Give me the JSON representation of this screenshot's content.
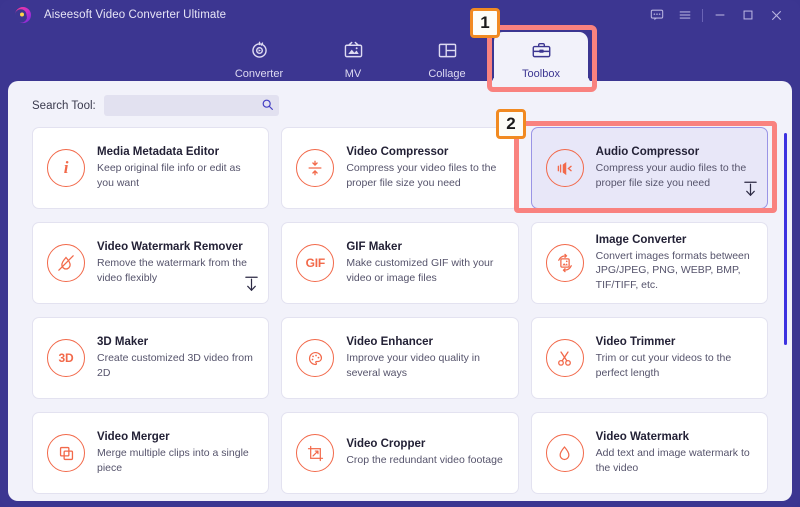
{
  "window": {
    "app_title": "Aiseesoft Video Converter Ultimate",
    "logo_icon": "aiseesoft-logo-icon",
    "controls": [
      {
        "name": "feedback-icon",
        "label": "feedback"
      },
      {
        "name": "menu-icon",
        "label": "menu"
      },
      {
        "name": "minimize-icon",
        "label": "minimize"
      },
      {
        "name": "maximize-icon",
        "label": "maximize"
      },
      {
        "name": "close-icon",
        "label": "close"
      }
    ],
    "colors": {
      "titlebar_bg": "#3c3691",
      "panel_bg": "#f2f2fa",
      "accent_orange": "#f2694a",
      "highlight_red": "#f9827f",
      "badge_orange": "#f18a21",
      "scrollbar": "#3d32e0"
    }
  },
  "nav": {
    "tabs": [
      {
        "label": "Converter",
        "icon": "converter-icon",
        "active": false
      },
      {
        "label": "MV",
        "icon": "mv-icon",
        "active": false
      },
      {
        "label": "Collage",
        "icon": "collage-icon",
        "active": false
      },
      {
        "label": "Toolbox",
        "icon": "toolbox-icon",
        "active": true
      }
    ]
  },
  "search": {
    "label": "Search Tool:",
    "value": "",
    "placeholder": "",
    "icon": "search-icon"
  },
  "tools": [
    {
      "title": "Media Metadata Editor",
      "desc": "Keep original file info or edit as you want",
      "icon": "info-circle-icon",
      "icon_text": "i",
      "selected": false,
      "download": false
    },
    {
      "title": "Video Compressor",
      "desc": "Compress your video files to the proper file size you need",
      "icon": "video-compressor-icon",
      "icon_text": "",
      "selected": false,
      "download": false
    },
    {
      "title": "Audio Compressor",
      "desc": "Compress your audio files to the proper file size you need",
      "icon": "audio-compressor-icon",
      "icon_text": "",
      "selected": true,
      "download": true
    },
    {
      "title": "Video Watermark Remover",
      "desc": "Remove the watermark from the video flexibly",
      "icon": "watermark-remover-icon",
      "icon_text": "",
      "selected": false,
      "download": true
    },
    {
      "title": "GIF Maker",
      "desc": "Make customized GIF with your video or image files",
      "icon": "gif-icon",
      "icon_text": "GIF",
      "selected": false,
      "download": false
    },
    {
      "title": "Image Converter",
      "desc": "Convert images formats between JPG/JPEG, PNG, WEBP, BMP, TIF/TIFF, etc.",
      "icon": "image-converter-icon",
      "icon_text": "",
      "selected": false,
      "download": false
    },
    {
      "title": "3D Maker",
      "desc": "Create customized 3D video from 2D",
      "icon": "three-d-icon",
      "icon_text": "3D",
      "selected": false,
      "download": false
    },
    {
      "title": "Video Enhancer",
      "desc": "Improve your video quality in several ways",
      "icon": "video-enhancer-icon",
      "icon_text": "",
      "selected": false,
      "download": false
    },
    {
      "title": "Video Trimmer",
      "desc": "Trim or cut your videos to the perfect length",
      "icon": "scissors-icon",
      "icon_text": "",
      "selected": false,
      "download": false
    },
    {
      "title": "Video Merger",
      "desc": "Merge multiple clips into a single piece",
      "icon": "merge-icon",
      "icon_text": "",
      "selected": false,
      "download": false
    },
    {
      "title": "Video Cropper",
      "desc": "Crop the redundant video footage",
      "icon": "crop-icon",
      "icon_text": "",
      "selected": false,
      "download": false
    },
    {
      "title": "Video Watermark",
      "desc": "Add text and image watermark to the video",
      "icon": "watermark-icon",
      "icon_text": "",
      "selected": false,
      "download": false
    }
  ],
  "annotations": [
    {
      "number": "1",
      "target": "toolbox-tab"
    },
    {
      "number": "2",
      "target": "audio-compressor-card"
    }
  ]
}
